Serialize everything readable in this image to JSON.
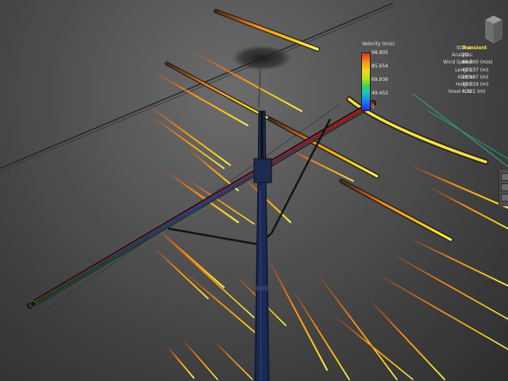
{
  "legend": {
    "title": "Velocity (m/s)",
    "ticks": [
      "98.905",
      "85.654",
      "69.936",
      "49.452",
      "0"
    ]
  },
  "info": {
    "rows": [
      {
        "label": "Status:",
        "value": "Transient"
      },
      {
        "label": "Analysis:",
        "value": "2D"
      },
      {
        "label": "Wind Speed:",
        "value": "88.000 (m/s)"
      },
      {
        "label": "Length:",
        "value": "47.237 (m)"
      },
      {
        "label": "Width:",
        "value": "26.987 (m)"
      },
      {
        "label": "Height:",
        "value": "35.019 (m)"
      },
      {
        "label": "Voxel size:",
        "value": "0.321 (m)"
      }
    ]
  },
  "colors": {
    "streak_core": "#ffd21a",
    "streak_edge": "#ff7a10",
    "pole": "#1b2a55",
    "background": "#4f4f4f",
    "status_accent": "#ffe23a"
  },
  "icons": {
    "view_cube": "view-cube-icon"
  }
}
